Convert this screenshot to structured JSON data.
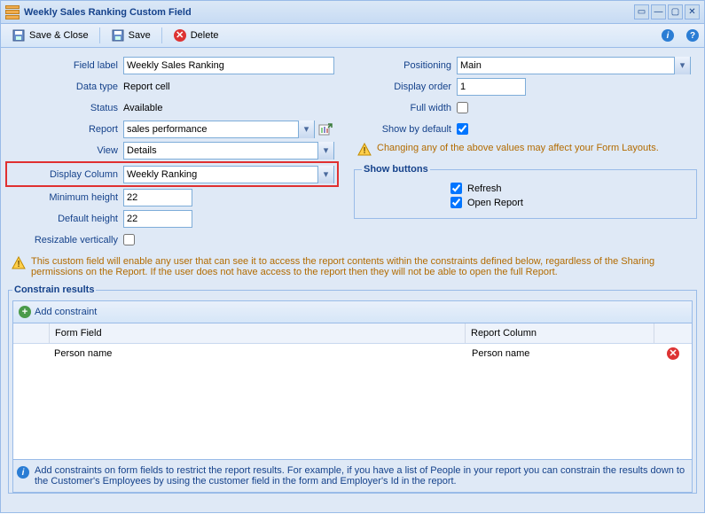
{
  "title": "Weekly Sales Ranking Custom Field",
  "toolbar": {
    "save_close": "Save & Close",
    "save": "Save",
    "delete": "Delete"
  },
  "left": {
    "field_label_l": "Field label",
    "field_label_v": "Weekly Sales Ranking",
    "data_type_l": "Data type",
    "data_type_v": "Report cell",
    "status_l": "Status",
    "status_v": "Available",
    "report_l": "Report",
    "report_v": "sales performance",
    "view_l": "View",
    "view_v": "Details",
    "disp_col_l": "Display Column",
    "disp_col_v": "Weekly Ranking",
    "min_h_l": "Minimum height",
    "min_h_v": "22",
    "def_h_l": "Default height",
    "def_h_v": "22",
    "resize_l": "Resizable vertically"
  },
  "right": {
    "positioning_l": "Positioning",
    "positioning_v": "Main",
    "order_l": "Display order",
    "order_v": "1",
    "fullwidth_l": "Full width",
    "showdefault_l": "Show by default",
    "warn": "Changing any of the above values may affect your Form Layouts.",
    "showbtns_legend": "Show buttons",
    "refresh_l": "Refresh",
    "openreport_l": "Open Report"
  },
  "mid_warn": "This custom field will enable any user that can see it to access the report contents within the constraints defined below, regardless of the Sharing permissions on the Report. If the user does not have access to the report then they will not be able to open the full Report.",
  "constrain": {
    "legend": "Constrain results",
    "add": "Add constraint",
    "col_form": "Form Field",
    "col_report": "Report Column",
    "row_form": "Person name",
    "row_report": "Person name",
    "info": "Add constraints on form fields to restrict the report results. For example, if you have a list of People in your report you can constrain the results down to the Customer's Employees by using the customer field in the form and Employer's Id in the report."
  }
}
